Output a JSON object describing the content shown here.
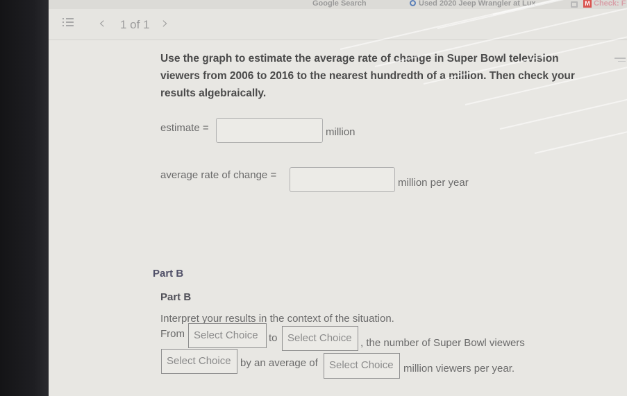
{
  "browser": {
    "bookmarks": [
      {
        "label": "Google Search",
        "icon": "google-icon"
      },
      {
        "label": "Used 2020 Jeep Wrangler at Lux",
        "icon": "site-icon"
      },
      {
        "label": "",
        "icon": "video-icon"
      },
      {
        "label": "Check: F",
        "icon": "mcgraw-hill-icon"
      }
    ]
  },
  "toolbar": {
    "list_icon": "list-icon",
    "prev": "‹",
    "page_indicator": "1 of 1",
    "next": "›"
  },
  "question": {
    "prompt": "Use the graph to estimate the average rate of change in Super Bowl television viewers from 2006 to 2016 to the nearest hundredth of a million. Then check your results algebraically.",
    "estimate": {
      "label": "estimate =",
      "value": "",
      "unit": "million"
    },
    "rate": {
      "label": "average rate of change =",
      "value": "",
      "unit": "million per year"
    }
  },
  "part_b": {
    "heading": "Part B",
    "subheading": "Part B",
    "instruction": "Interpret your results in the context of the situation.",
    "sentence": {
      "from": "From",
      "to": "to",
      "viewers": ", the number of Super Bowl viewers",
      "by_avg": "by an average of",
      "per_year": "million viewers per year."
    },
    "selects": [
      {
        "value": "Select Choice"
      },
      {
        "value": "Select Choice"
      },
      {
        "value": "Select Choice"
      },
      {
        "value": "Select Choice"
      }
    ]
  }
}
